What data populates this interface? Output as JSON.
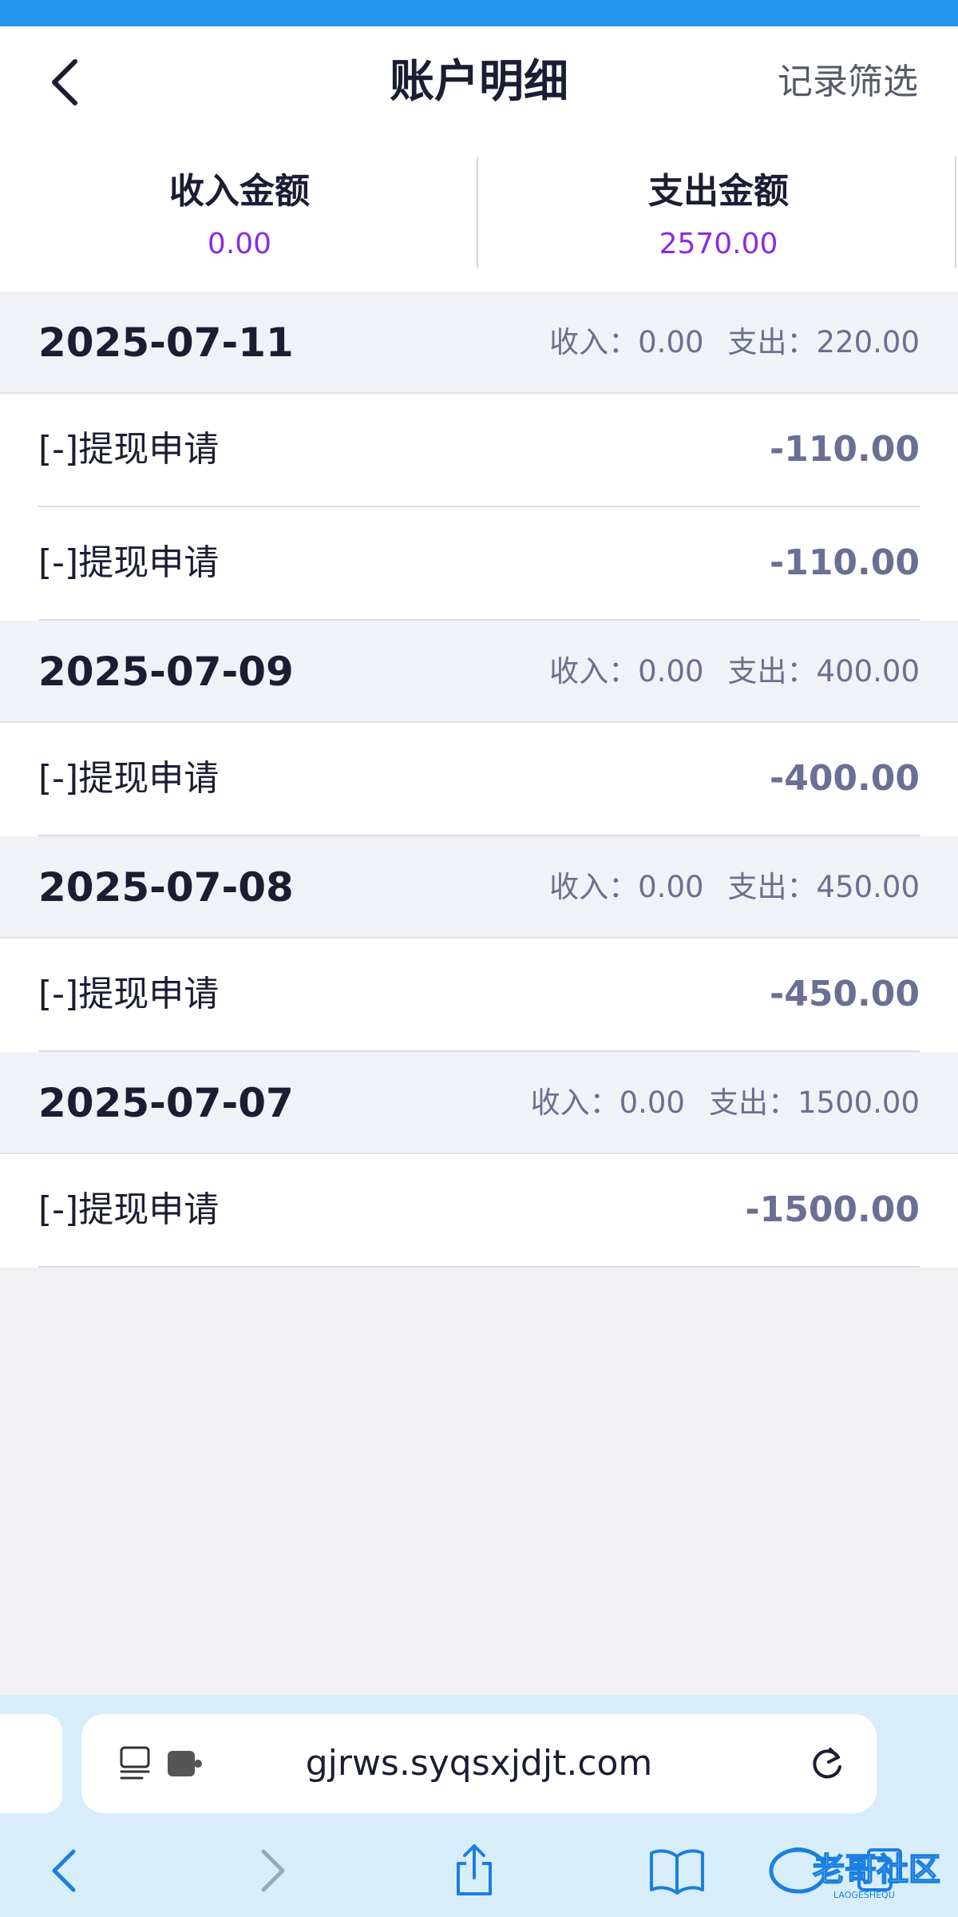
{
  "header": {
    "title": "账户明细",
    "filter_label": "记录筛选"
  },
  "summary": {
    "income_label": "收入金额",
    "income_value": "0.00",
    "expense_label": "支出金额",
    "expense_value": "2570.00"
  },
  "groups": [
    {
      "date": "2025-07-11",
      "income": "收入：0.00",
      "expense": "支出：220.00",
      "items": [
        {
          "name": "[-]提现申请",
          "amount": "-110.00"
        },
        {
          "name": "[-]提现申请",
          "amount": "-110.00"
        }
      ]
    },
    {
      "date": "2025-07-09",
      "income": "收入：0.00",
      "expense": "支出：400.00",
      "items": [
        {
          "name": "[-]提现申请",
          "amount": "-400.00"
        }
      ]
    },
    {
      "date": "2025-07-08",
      "income": "收入：0.00",
      "expense": "支出：450.00",
      "items": [
        {
          "name": "[-]提现申请",
          "amount": "-450.00"
        }
      ]
    },
    {
      "date": "2025-07-07",
      "income": "收入：0.00",
      "expense": "支出：1500.00",
      "items": [
        {
          "name": "[-]提现申请",
          "amount": "-1500.00"
        }
      ]
    }
  ],
  "browser": {
    "url": "gjrws.syqsxjdjt.com",
    "watermark_text": "老哥社区",
    "watermark_sub": "LAOGESHEQU"
  },
  "colors": {
    "accent_top": "#2394ee",
    "summary_value": "#8b2be2",
    "amount": "#6a6f95"
  }
}
